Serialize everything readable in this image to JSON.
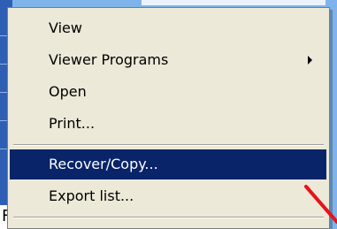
{
  "context_menu": {
    "items": [
      {
        "label": "View"
      },
      {
        "label": "Viewer Programs"
      },
      {
        "label": "Open"
      },
      {
        "label": "Print..."
      },
      {
        "label": "Recover/Copy..."
      },
      {
        "label": "Export list..."
      }
    ],
    "selected_item": "Recover/Copy..."
  },
  "background": {
    "partial_text": "F"
  },
  "colors": {
    "menu_background": "#ece9d8",
    "selection_highlight": "#0a246a",
    "annotation_arrow": "#e8131b",
    "desktop_background": "#7fb4ea"
  },
  "icons": [
    "submenu-arrow-icon",
    "annotation-arrow-icon"
  ]
}
